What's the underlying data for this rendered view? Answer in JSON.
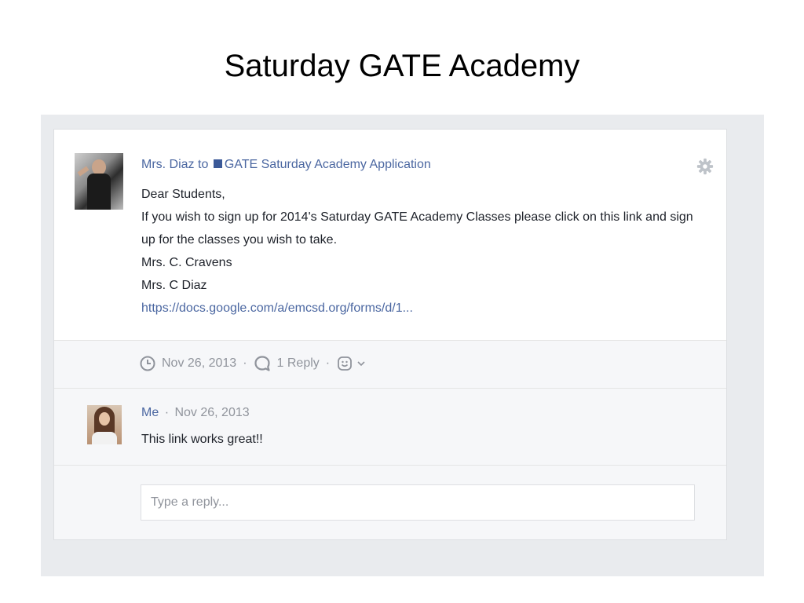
{
  "slide": {
    "title": "Saturday GATE Academy"
  },
  "post": {
    "author": "Mrs. Diaz",
    "to_word": "to",
    "group": "GATE Saturday Academy Application",
    "body_lines": [
      "Dear Students,",
      "If you wish to sign up for 2014's Saturday GATE Academy Classes please click on this link and sign up for the classes you wish to take.",
      "Mrs. C. Cravens",
      "Mrs. C Diaz"
    ],
    "link": "https://docs.google.com/a/emcsd.org/forms/d/1...",
    "meta": {
      "date": "Nov 26, 2013",
      "separator": "·",
      "replies": "1 Reply"
    }
  },
  "reply": {
    "author": "Me",
    "separator": "·",
    "date": "Nov 26, 2013",
    "text": "This link works great!!"
  },
  "compose": {
    "placeholder": "Type a reply..."
  },
  "icons": {
    "gear": "gear-icon",
    "clock": "clock-icon",
    "reply": "reply-bubble-icon",
    "emoji": "emoji-reaction-icon",
    "chevron": "chevron-down-icon"
  },
  "colors": {
    "link": "#4b67a1",
    "meta": "#90949c",
    "group_square": "#3b5998",
    "background": "#e9ebee"
  }
}
